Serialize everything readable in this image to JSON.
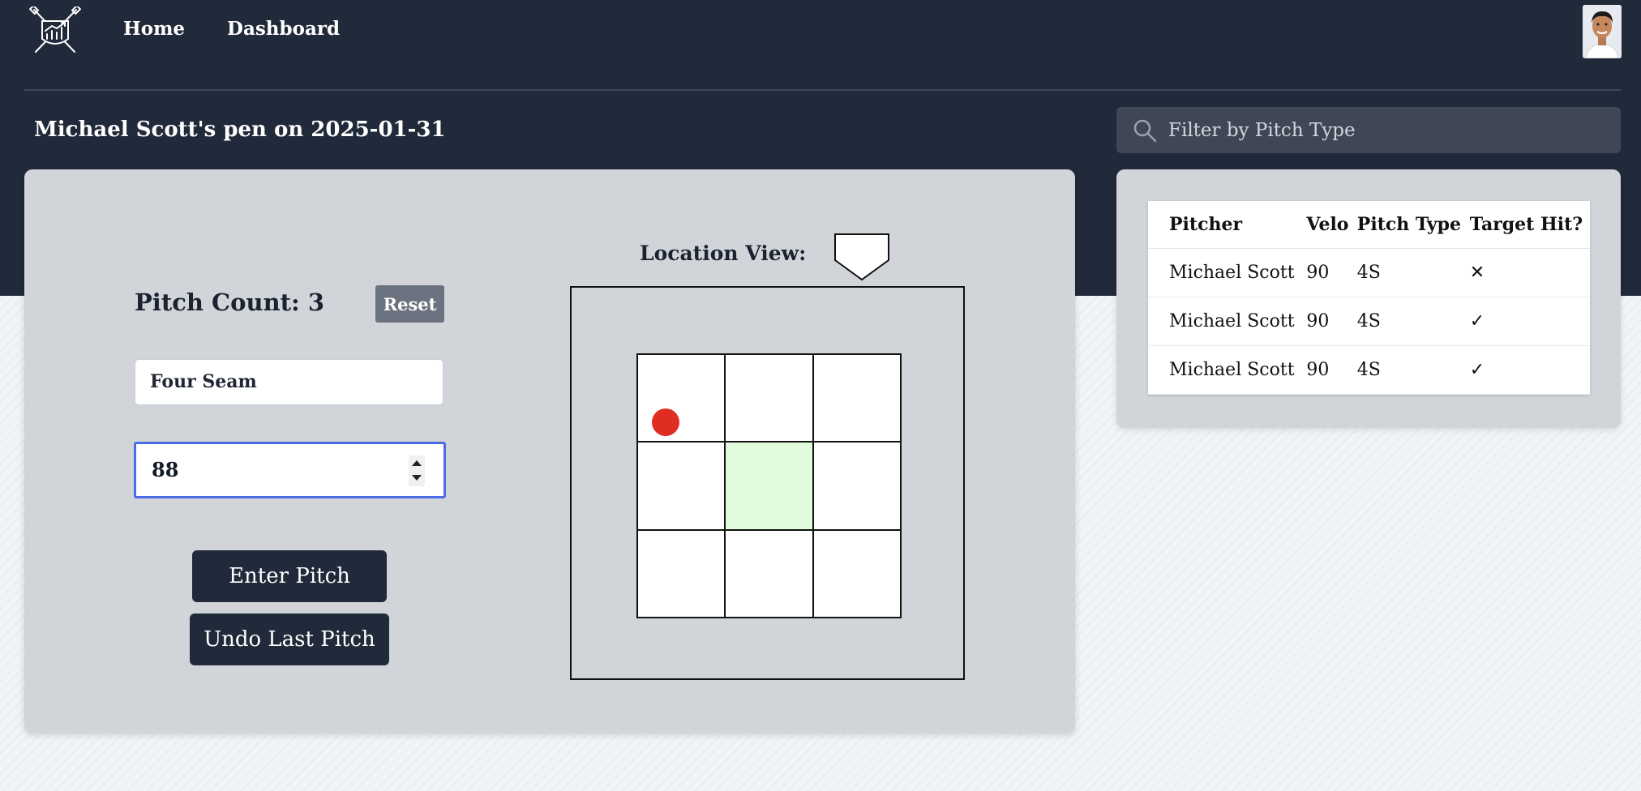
{
  "nav": {
    "home_label": "Home",
    "dashboard_label": "Dashboard"
  },
  "session": {
    "title": "Michael Scott's pen on 2025-01-31"
  },
  "filter": {
    "placeholder": "Filter by Pitch Type"
  },
  "entry": {
    "pitch_count_text": "Pitch Count: 3",
    "reset_label": "Reset",
    "pitch_type_value": "Four Seam",
    "velocity_value": "88",
    "enter_label": "Enter Pitch",
    "undo_label": "Undo Last Pitch"
  },
  "location": {
    "label": "Location View:",
    "target_zone": "middle-center",
    "marker_color": "#e02d22",
    "target_color": "#e2fbdc"
  },
  "log": {
    "headers": [
      "Pitcher",
      "Velo",
      "Pitch Type",
      "Target Hit?"
    ],
    "rows": [
      {
        "pitcher": "Michael Scott",
        "velo": "90",
        "type": "4S",
        "hit": "✕"
      },
      {
        "pitcher": "Michael Scott",
        "velo": "90",
        "type": "4S",
        "hit": "✓"
      },
      {
        "pitcher": "Michael Scott",
        "velo": "90",
        "type": "4S",
        "hit": "✓"
      }
    ]
  },
  "colors": {
    "header_bg": "#212a3a",
    "card_bg": "#d1d5da",
    "focus_border": "#4a6de5",
    "miss": "#d62f2f",
    "hit": "#2ea043"
  },
  "icons": {
    "logo": "baseball-bats-chart-logo",
    "search": "search-icon",
    "plate": "home-plate-icon"
  }
}
